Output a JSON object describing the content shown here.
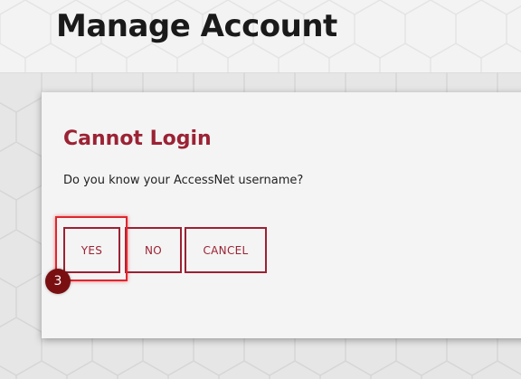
{
  "header": {
    "title": "Manage Account"
  },
  "dialog": {
    "title": "Cannot Login",
    "message": "Do you know your AccessNet username?",
    "buttons": {
      "yes": "YES",
      "no": "NO",
      "cancel": "CANCEL"
    }
  },
  "annotation": {
    "step_number": "3"
  },
  "colors": {
    "accent": "#9b2234",
    "highlight": "#e0262e",
    "badge": "#7a0f12"
  }
}
